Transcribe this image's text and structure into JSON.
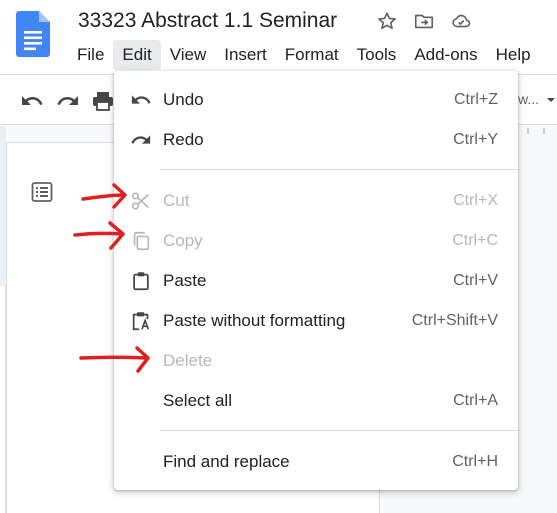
{
  "document": {
    "title": "33323 Abstract 1.1 Seminar"
  },
  "menubar": [
    "File",
    "Edit",
    "View",
    "Insert",
    "Format",
    "Tools",
    "Add-ons",
    "Help"
  ],
  "toolbar": {
    "font_fragment": "w..."
  },
  "edit_menu": {
    "undo": {
      "label": "Undo",
      "shortcut": "Ctrl+Z"
    },
    "redo": {
      "label": "Redo",
      "shortcut": "Ctrl+Y"
    },
    "cut": {
      "label": "Cut",
      "shortcut": "Ctrl+X",
      "state": "disabled"
    },
    "copy": {
      "label": "Copy",
      "shortcut": "Ctrl+C",
      "state": "disabled"
    },
    "paste": {
      "label": "Paste",
      "shortcut": "Ctrl+V"
    },
    "paste_plain": {
      "label": "Paste without formatting",
      "shortcut": "Ctrl+Shift+V"
    },
    "delete": {
      "label": "Delete",
      "shortcut": "",
      "state": "disabled"
    },
    "select_all": {
      "label": "Select all",
      "shortcut": "Ctrl+A"
    },
    "find_replace": {
      "label": "Find and replace",
      "shortcut": "Ctrl+H"
    }
  },
  "annotations": {
    "arrow_color": "#e02020",
    "pointing_at": [
      "Cut",
      "Copy",
      "Delete"
    ]
  },
  "colors": {
    "docs_blue": "#4285f4",
    "menu_active_bg": "#e8eaed",
    "disabled_text": "#b5b8bb"
  }
}
